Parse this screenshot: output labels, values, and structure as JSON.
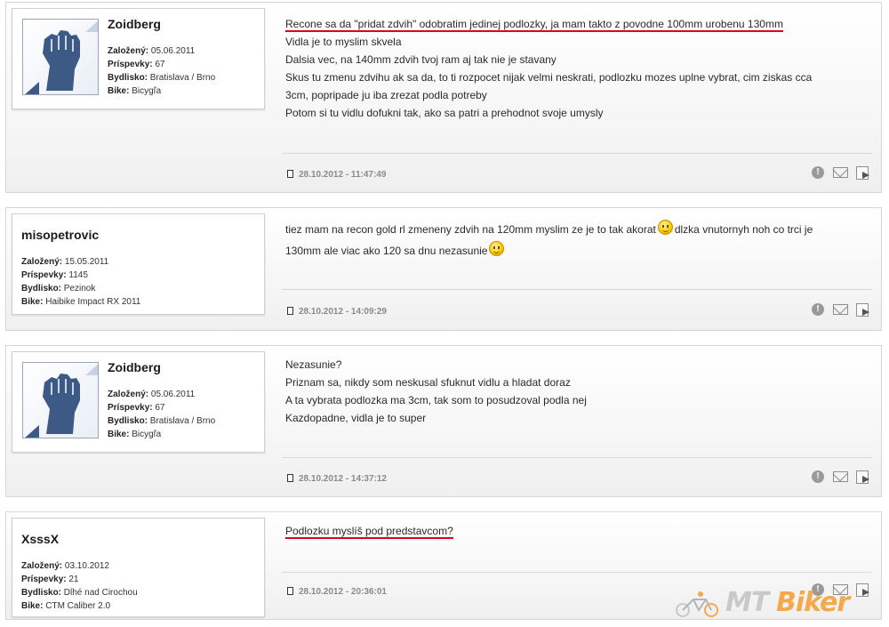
{
  "posts": [
    {
      "username": "Zoidberg",
      "has_avatar": true,
      "info": [
        {
          "label": "Založený:",
          "value": "05.06.2011"
        },
        {
          "label": "Príspevky:",
          "value": "67"
        },
        {
          "label": "Bydlisko:",
          "value": "Bratislava / Brno"
        },
        {
          "label": "Bike:",
          "value": "Bicygľa"
        }
      ],
      "lines": [
        "Recone sa da \"pridat zdvih\" odobratim jedinej podlozky, ja mam takto z povodne 100mm urobenu 130mm",
        "Vidla je to myslim skvela",
        "Dalsia vec, na 140mm zdvih tvoj ram aj tak nie je stavany",
        "Skus tu zmenu zdvihu ak sa da, to ti rozpocet nijak velmi neskrati, podlozku mozes uplne vybrat, cim ziskas cca",
        "3cm, popripade ju iba zrezat podla potreby",
        "Potom si tu vidlu dofukni tak, ako sa patri a prehodnot svoje umysly"
      ],
      "date": "28.10.2012 - 11:47:49"
    },
    {
      "username": "misopetrovic",
      "has_avatar": false,
      "info": [
        {
          "label": "Založený:",
          "value": "15.05.2011"
        },
        {
          "label": "Príspevky:",
          "value": "1145"
        },
        {
          "label": "Bydlisko:",
          "value": "Pezinok"
        },
        {
          "label": "Bike:",
          "value": "Haibike Impact RX 2011"
        }
      ],
      "lines": [
        "tiez mam na recon gold rl zmeneny zdvih na 120mm myslim ze je to tak akorat",
        "dlzka vnutornyh noh co trci je",
        "130mm ale viac ako 120 sa dnu nezasunie"
      ],
      "date": "28.10.2012 - 14:09:29"
    },
    {
      "username": "Zoidberg",
      "has_avatar": true,
      "info": [
        {
          "label": "Založený:",
          "value": "05.06.2011"
        },
        {
          "label": "Príspevky:",
          "value": "67"
        },
        {
          "label": "Bydlisko:",
          "value": "Bratislava / Brno"
        },
        {
          "label": "Bike:",
          "value": "Bicygľa"
        }
      ],
      "lines": [
        "Nezasunie?",
        "Priznam sa, nikdy som neskusal sfuknut vidlu a hladat doraz",
        "A ta vybrata podlozka ma 3cm, tak som to posudzoval podla nej",
        "Kazdopadne, vidla je to super"
      ],
      "date": "28.10.2012 - 14:37:12"
    },
    {
      "username": "XsssX",
      "has_avatar": false,
      "info": [
        {
          "label": "Založený:",
          "value": "03.10.2012"
        },
        {
          "label": "Príspevky:",
          "value": "21"
        },
        {
          "label": "Bydlisko:",
          "value": "Dlhé nad Cirochou"
        },
        {
          "label": "Bike:",
          "value": "CTM Caliber 2.0"
        }
      ],
      "lines": [
        "Podlozku myslíš pod predstavcom?"
      ],
      "date": "28.10.2012 - 20:36:01"
    }
  ],
  "icons": {
    "info": "info-icon",
    "info_glyph": "!",
    "mail": "envelope-icon",
    "quote": "quote-icon",
    "date": "document-icon"
  },
  "logo": {
    "part1": "MT",
    "part2": "Biker",
    "colors": {
      "mt": "#c9c9c9",
      "biker": "#f5a94a"
    }
  },
  "colors": {
    "highlight_underline": "#e0001a"
  }
}
